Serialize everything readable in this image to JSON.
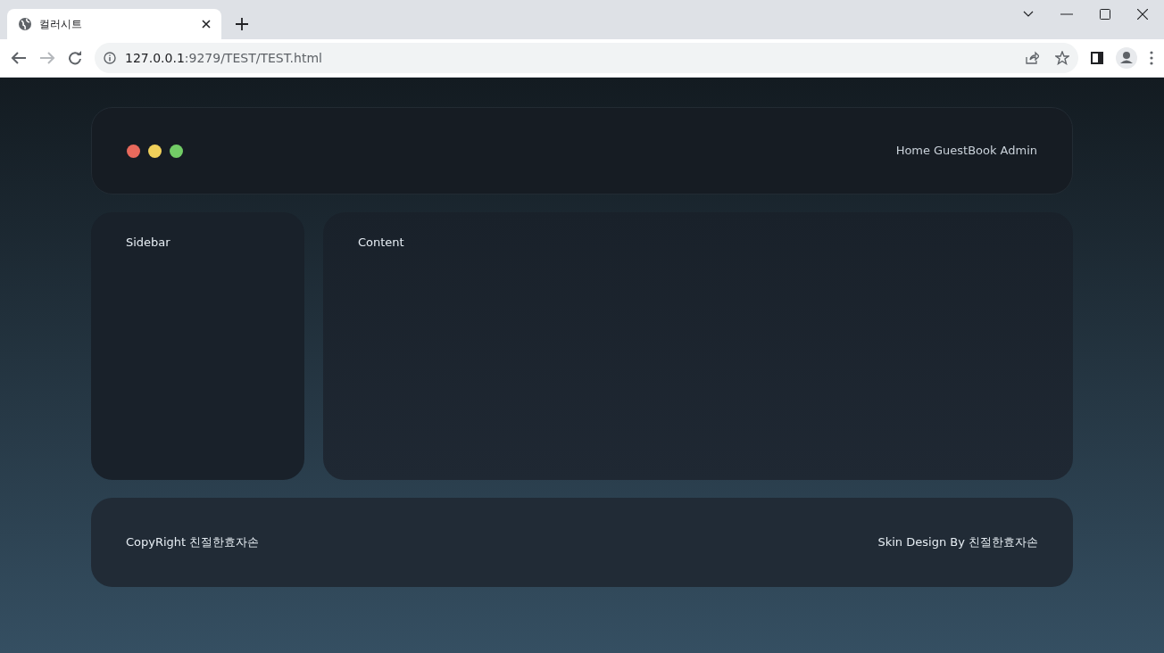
{
  "browser": {
    "tab": {
      "title": "컬러시트",
      "selected": true
    },
    "address": {
      "host": "127.0.0.1",
      "path": ":9279/TEST/TEST.html"
    }
  },
  "header": {
    "dots": [
      {
        "color": "#e8695c"
      },
      {
        "color": "#f0d05a"
      },
      {
        "color": "#72cc66"
      }
    ],
    "nav": [
      "Home",
      "GuestBook",
      "Admin"
    ]
  },
  "sidebar": {
    "title": "Sidebar"
  },
  "content": {
    "title": "Content"
  },
  "footer": {
    "left": "CopyRight 친절한효자손",
    "right": "Skin Design By 친절한효자손"
  }
}
